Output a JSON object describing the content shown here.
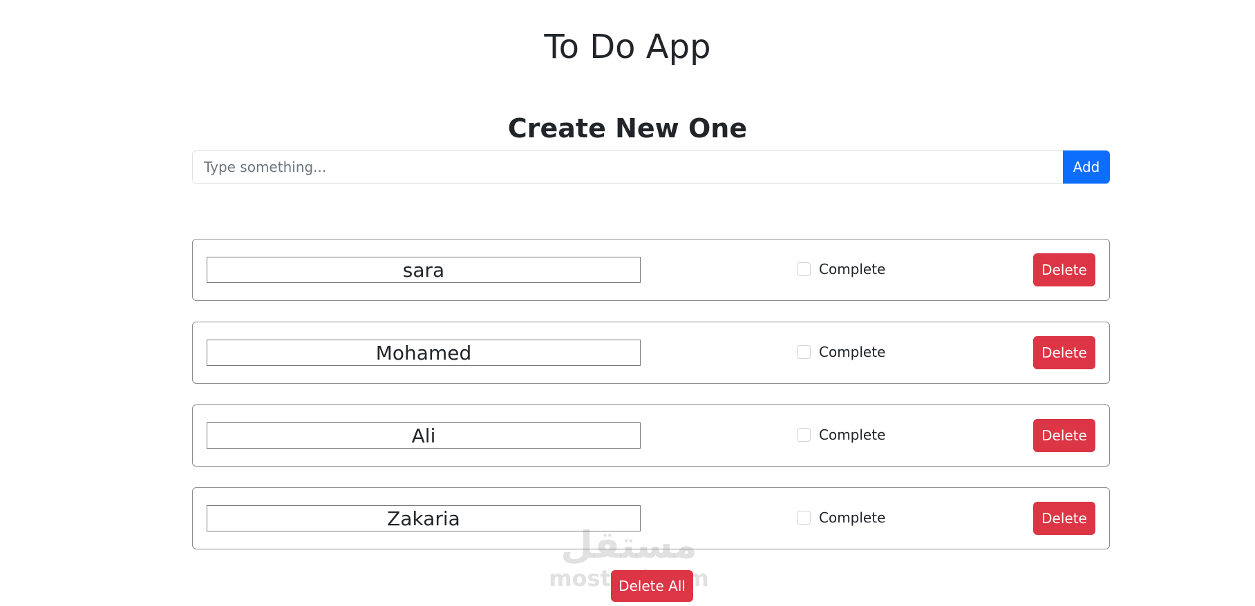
{
  "header": {
    "title": "To Do App"
  },
  "create": {
    "heading": "Create New One",
    "placeholder": "Type something...",
    "value": "",
    "add_label": "Add"
  },
  "todos": [
    {
      "name": "sara",
      "complete_label": "Complete",
      "completed": false,
      "delete_label": "Delete"
    },
    {
      "name": "Mohamed",
      "complete_label": "Complete",
      "completed": false,
      "delete_label": "Delete"
    },
    {
      "name": "Ali",
      "complete_label": "Complete",
      "completed": false,
      "delete_label": "Delete"
    },
    {
      "name": "Zakaria",
      "complete_label": "Complete",
      "completed": false,
      "delete_label": "Delete"
    }
  ],
  "footer": {
    "delete_all_label": "Delete All"
  },
  "watermark": {
    "arabic": "مستقل",
    "latin": "mostaql.com"
  },
  "colors": {
    "primary": "#0d6efd",
    "danger": "#dc3545",
    "text": "#212529"
  }
}
